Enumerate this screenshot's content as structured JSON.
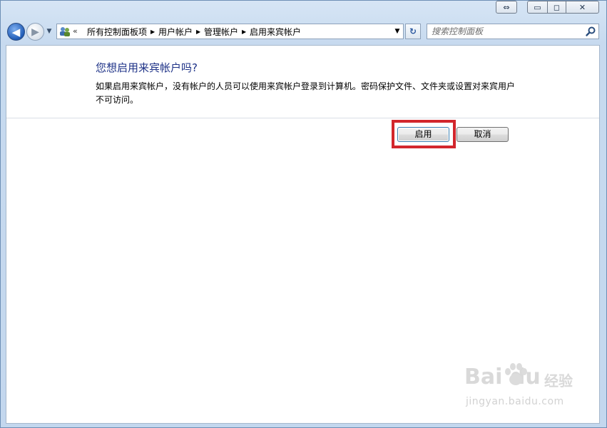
{
  "window": {
    "controls": {
      "resize_glyph": "⇔",
      "minimize_glyph": "▭",
      "maximize_glyph": "◻",
      "close_glyph": "✕"
    }
  },
  "nav": {
    "back_glyph": "◀",
    "forward_glyph": "▶",
    "history_glyph": "▼",
    "address_prefix": "«",
    "breadcrumbs": [
      "所有控制面板项",
      "用户帐户",
      "管理帐户",
      "启用来宾帐户"
    ],
    "breadcrumb_separator": "▶",
    "dropdown_glyph": "▼",
    "refresh_glyph": "↻",
    "search_placeholder": "搜索控制面板"
  },
  "dialog": {
    "title": "您想启用来宾帐户吗?",
    "body": "如果启用来宾帐户，没有帐户的人员可以使用来宾帐户登录到计算机。密码保护文件、文件夹或设置对来宾用户不可访问。",
    "enable_label": "启用",
    "cancel_label": "取消"
  },
  "watermark": {
    "brand": "Bai du",
    "tag": "经验",
    "url": "jingyan.baidu.com"
  },
  "colors": {
    "title_blue": "#1e3287",
    "highlight_red": "#d2262c",
    "frame_blue": "#c7daef"
  }
}
